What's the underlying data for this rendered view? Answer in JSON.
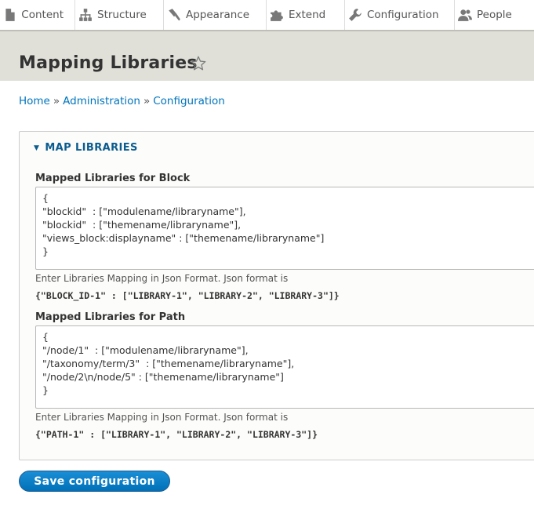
{
  "toolbar": {
    "items": [
      {
        "label": "Content",
        "icon": "file-icon"
      },
      {
        "label": "Structure",
        "icon": "sitemap-icon"
      },
      {
        "label": "Appearance",
        "icon": "paintbrush-icon"
      },
      {
        "label": "Extend",
        "icon": "puzzle-icon"
      },
      {
        "label": "Configuration",
        "icon": "wrench-icon"
      },
      {
        "label": "People",
        "icon": "people-icon"
      }
    ]
  },
  "page": {
    "title": "Mapping Libraries"
  },
  "breadcrumb": {
    "items": [
      "Home",
      "Administration",
      "Configuration"
    ],
    "separator": "»"
  },
  "fieldset": {
    "legend": "MAP LIBRARIES",
    "block": {
      "label": "Mapped Libraries for Block",
      "value": "{\n\"blockid\"  : [\"modulename/libraryname\"],\n\"blockid\"  : [\"themename/libraryname\"],\n\"views_block:displayname\" : [\"themename/libraryname\"]\n}",
      "description": "Enter Libraries Mapping in Json Format. Json format is",
      "format": "{\"BLOCK_ID-1\" : [\"LIBRARY-1\", \"LIBRARY-2\", \"LIBRARY-3\"]}"
    },
    "path": {
      "label": "Mapped Libraries for Path",
      "value": "{\n\"/node/1\"  : [\"modulename/libraryname\"],\n\"/taxonomy/term/3\"  : [\"themename/libraryname\"],\n\"/node/2\\n/node/5\" : [\"themename/libraryname\"]\n}",
      "description": "Enter Libraries Mapping in Json Format. Json format is",
      "format": "{\"PATH-1\" : [\"LIBRARY-1\", \"LIBRARY-2\", \"LIBRARY-3\"]}"
    }
  },
  "actions": {
    "save_label": "Save configuration"
  },
  "colors": {
    "link": "#0074bd",
    "header_bg": "#e0e0d8",
    "button": "#0071b8"
  }
}
